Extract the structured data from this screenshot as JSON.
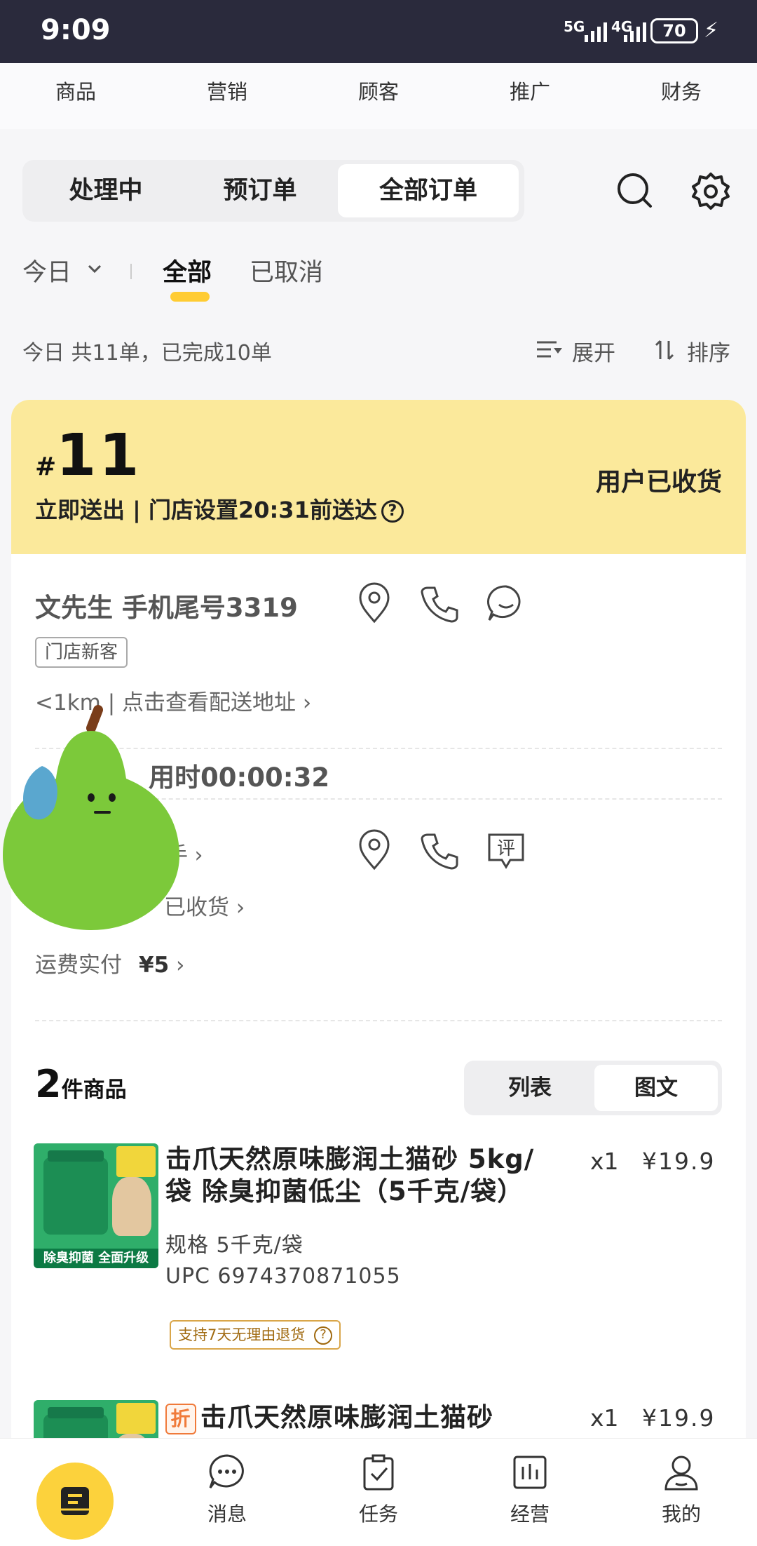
{
  "status_bar": {
    "time": "9:09",
    "network1": "5G",
    "network2": "4G",
    "battery": "70"
  },
  "top_nav": {
    "items": [
      "商品",
      "营销",
      "顾客",
      "推广",
      "财务"
    ]
  },
  "order_tabs": {
    "items": [
      "处理中",
      "预订单",
      "全部订单"
    ],
    "active": "全部订单"
  },
  "filters": {
    "date": "今日",
    "all": "全部",
    "cancelled": "已取消"
  },
  "summary": {
    "text": "今日  共11单，已完成10单",
    "expand": "展开",
    "sort": "排序"
  },
  "order": {
    "hash": "#",
    "number": "11",
    "delivery": "立即送出  |  门店设置20:31前送达",
    "state": "用户已收货",
    "customer": "文先生 手机尾号3319",
    "customer_tag": "门店新客",
    "address_link": "<1km | 点击查看配送地址",
    "elapsed": "用时00:00:32",
    "rider": "手",
    "rider_status": "已收货",
    "fee_label": "运费实付",
    "fee_value": "¥5",
    "item_count": "2",
    "item_count_label": "件商品",
    "view_toggle": [
      "列表",
      "图文"
    ],
    "view_active": "图文",
    "items": [
      {
        "name_line1": "击爪天然原味膨润土猫砂  5kg/",
        "name_line2": "袋   除臭抑菌低尘（5千克/袋）",
        "qty": "x1",
        "price": "¥19.9",
        "spec": "规格  5千克/袋",
        "upc": "UPC  6974370871055",
        "return_policy": "支持7天无理由退货",
        "thumb_strip": "除臭抑菌 全面升级"
      },
      {
        "discount_tag": "折",
        "name_line1": "击爪天然原味膨润土猫砂",
        "qty": "x1",
        "price": "¥19.9"
      }
    ]
  },
  "bottom_tabs": {
    "items": [
      "消息",
      "任务",
      "经营",
      "我的"
    ]
  },
  "colors": {
    "accent": "#fcd23c",
    "header_bg": "#fbe99b",
    "status_bar": "#2a2a3c"
  }
}
